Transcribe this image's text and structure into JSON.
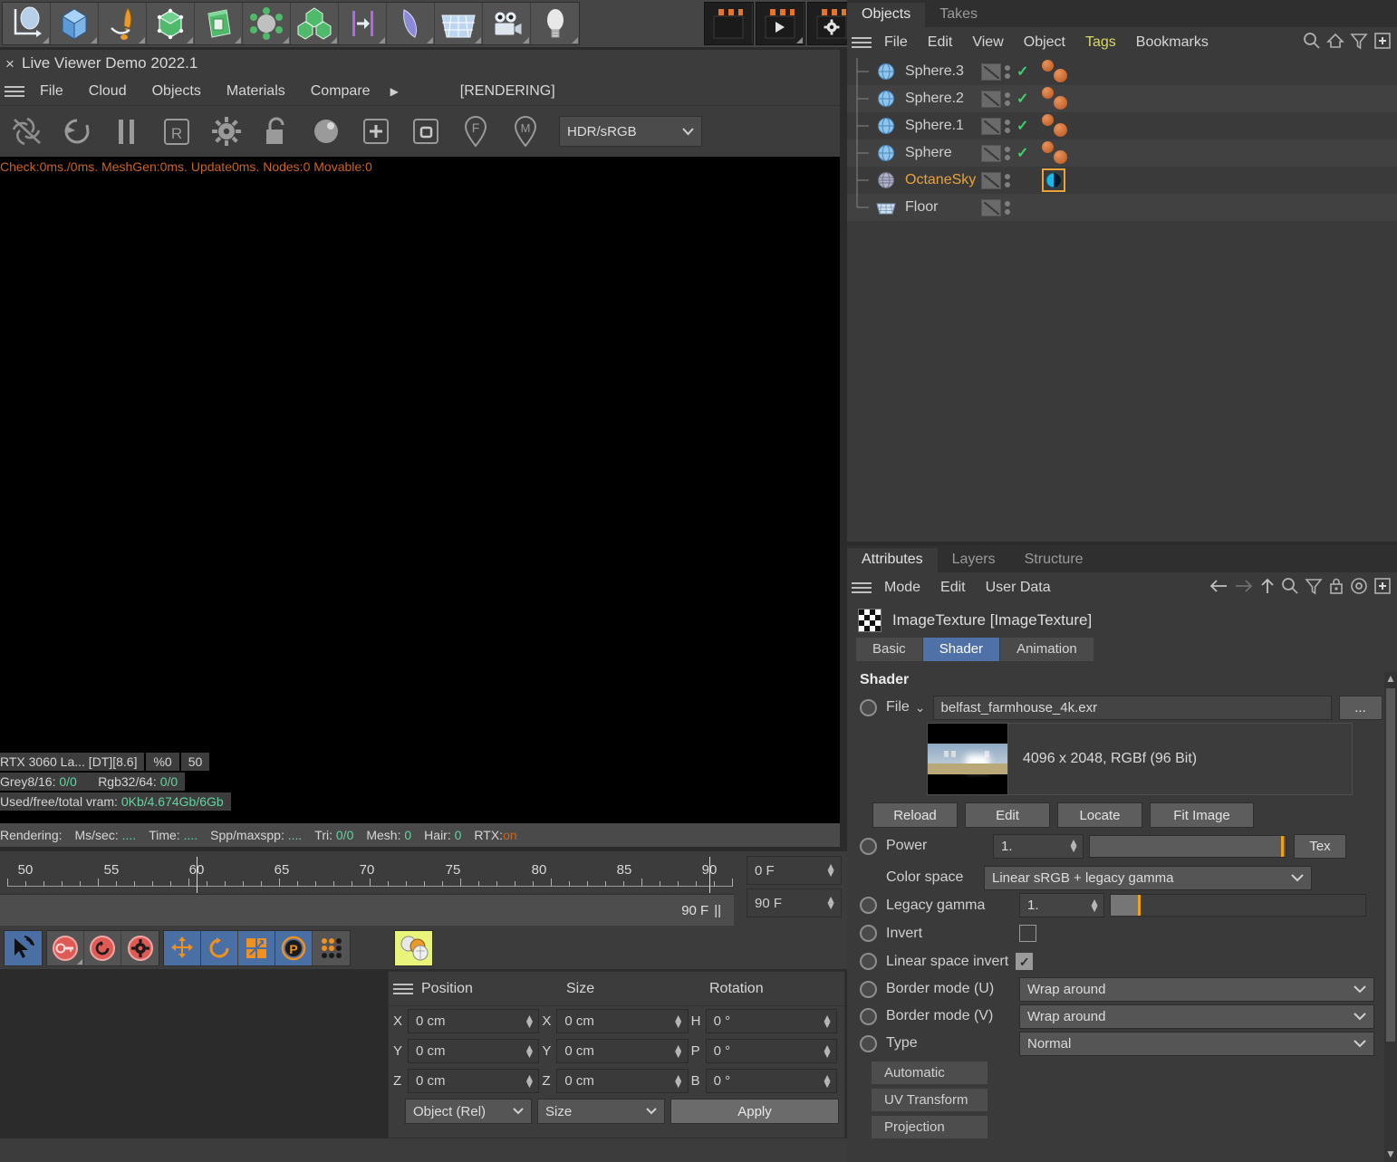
{
  "app": {
    "top_toolbar_icons": [
      "spline-pen-icon",
      "cube-primitive-icon",
      "pen-tool-icon",
      "subdivision-cube-icon",
      "extrude-cube-icon",
      "deformer-icon",
      "cloner-array-icon",
      "mograph-effector-icon",
      "bend-deformer-icon",
      "floor-grid-icon",
      "camera-icon",
      "light-bulb-icon"
    ],
    "render_buttons": [
      "render-view-icon",
      "render-play-icon",
      "render-settings-icon"
    ]
  },
  "live_viewer": {
    "title": "Live Viewer Demo 2022.1",
    "close_label": "×",
    "menu": [
      "File",
      "Cloud",
      "Objects",
      "Materials",
      "Compare"
    ],
    "menu_more": "▶",
    "render_state": "[RENDERING]",
    "toolbar_icons": [
      "stop-render-icon",
      "refresh-render-icon",
      "pause-render-icon",
      "region-render-icon",
      "render-settings-gear-icon",
      "lock-resolution-icon",
      "material-preview-icon",
      "add-object-icon",
      "add-region-icon",
      "focus-picker-icon",
      "material-picker-icon"
    ],
    "colorspace": "HDR/sRGB",
    "status_line": "Check:0ms./0ms.  MeshGen:0ms.  Update0ms.  Nodes:0  Movable:0",
    "stats": {
      "device": "RTX 3060 La... [DT][8.6]",
      "percent": "%0",
      "value": "50",
      "grey_label": "Grey8/16:",
      "grey_value": "0/0",
      "rgb_label": "Rgb32/64:",
      "rgb_value": "0/0",
      "vram_label": "Used/free/total vram:",
      "vram_value": "0Kb/4.674Gb/6Gb"
    },
    "bottom_status": {
      "rendering": "Rendering:",
      "mssec_label": "Ms/sec:",
      "mssec_value": "....",
      "time_label": "Time:",
      "time_value": "....",
      "spp_label": "Spp/maxspp:",
      "spp_value": "....",
      "tri_label": "Tri:",
      "tri_value": "0/0",
      "mesh_label": "Mesh:",
      "mesh_value": "0",
      "hair_label": "Hair:",
      "hair_value": "0",
      "rtx_label": "RTX:",
      "rtx_value": "on"
    }
  },
  "timeline": {
    "ticks": [
      "50",
      "55",
      "60",
      "65",
      "70",
      "75",
      "80",
      "85",
      "90"
    ],
    "current_frame": "0 F",
    "end_frame_track": "90 F",
    "end_frame": "90 F",
    "preview_handle": "||"
  },
  "bottom_toolbar": {
    "groups": [
      {
        "icons": [
          {
            "name": "selection-live-icon",
            "style": "blue"
          }
        ]
      },
      {
        "icons": [
          {
            "name": "key-record-icon",
            "style": "dark"
          },
          {
            "name": "autokey-icon",
            "style": "dark"
          },
          {
            "name": "keyframe-settings-icon",
            "style": "dark"
          }
        ]
      },
      {
        "icons": [
          {
            "name": "position-record-icon",
            "style": "blue"
          },
          {
            "name": "rotation-record-icon",
            "style": "blue"
          },
          {
            "name": "scale-record-icon",
            "style": "blue"
          },
          {
            "name": "pla-record-icon",
            "style": "blue"
          },
          {
            "name": "point-level-anim-icon",
            "style": "dark"
          }
        ]
      },
      {
        "icons": [
          {
            "name": "material-manager-icon",
            "style": "yellow"
          }
        ]
      }
    ]
  },
  "coordinates": {
    "columns": [
      "Position",
      "Size",
      "Rotation"
    ],
    "rows": [
      {
        "pos_axis": "X",
        "pos_value": "0 cm",
        "size_axis": "X",
        "size_value": "0 cm",
        "rot_axis": "H",
        "rot_value": "0 °"
      },
      {
        "pos_axis": "Y",
        "pos_value": "0 cm",
        "size_axis": "Y",
        "size_value": "0 cm",
        "rot_axis": "P",
        "rot_value": "0 °"
      },
      {
        "pos_axis": "Z",
        "pos_value": "0 cm",
        "size_axis": "Z",
        "size_value": "0 cm",
        "rot_axis": "B",
        "rot_value": "0 °"
      }
    ],
    "mode_select": "Object (Rel)",
    "size_select": "Size",
    "apply_label": "Apply"
  },
  "objects_panel": {
    "tabs": [
      {
        "label": "Objects",
        "active": true
      },
      {
        "label": "Takes",
        "active": false
      }
    ],
    "menu": [
      {
        "label": "File",
        "highlight": false
      },
      {
        "label": "Edit",
        "highlight": false
      },
      {
        "label": "View",
        "highlight": false
      },
      {
        "label": "Object",
        "highlight": false
      },
      {
        "label": "Tags",
        "highlight": true
      },
      {
        "label": "Bookmarks",
        "highlight": false
      }
    ],
    "header_icons": [
      "search-icon",
      "home-icon",
      "filter-icon",
      "plus-icon"
    ],
    "items": [
      {
        "label": "Sphere.3",
        "icon": "sphere-icon",
        "visible_check": true,
        "tags": "two-material-tags",
        "selected": false
      },
      {
        "label": "Sphere.2",
        "icon": "sphere-icon",
        "visible_check": true,
        "tags": "two-material-tags",
        "selected": false
      },
      {
        "label": "Sphere.1",
        "icon": "sphere-icon",
        "visible_check": true,
        "tags": "two-material-tags",
        "selected": false
      },
      {
        "label": "Sphere",
        "icon": "sphere-icon",
        "visible_check": true,
        "tags": "two-material-tags",
        "selected": false
      },
      {
        "label": "OctaneSky",
        "icon": "octane-sky-icon",
        "visible_check": false,
        "tags": "octane-sky-tag",
        "selected": true
      },
      {
        "label": "Floor",
        "icon": "floor-icon",
        "visible_check": false,
        "tags": "none",
        "selected": false
      }
    ]
  },
  "attributes_panel": {
    "tabs": [
      {
        "label": "Attributes",
        "active": true
      },
      {
        "label": "Layers",
        "active": false
      },
      {
        "label": "Structure",
        "active": false
      }
    ],
    "menu": [
      "Mode",
      "Edit",
      "User Data"
    ],
    "header_icons": [
      "back-arrow-icon",
      "forward-arrow-icon",
      "up-arrow-icon",
      "search-icon",
      "filter-icon",
      "lock-icon",
      "target-icon",
      "plus-icon"
    ],
    "object_title": "ImageTexture [ImageTexture]",
    "object_icon": "checker-texture-icon",
    "subtabs": [
      {
        "label": "Basic",
        "active": false
      },
      {
        "label": "Shader",
        "active": true
      },
      {
        "label": "Animation",
        "active": false
      }
    ],
    "section_title": "Shader",
    "file": {
      "label": "File",
      "dropdown_glyph": "⌄",
      "value": "belfast_farmhouse_4k.exr",
      "browse_label": "...",
      "image_info": "4096 x 2048, RGBf (96 Bit)",
      "buttons": [
        "Reload",
        "Edit",
        "Locate",
        "Fit Image"
      ]
    },
    "power": {
      "label": "Power",
      "value": "1.",
      "tex_button": "Tex"
    },
    "color_space": {
      "label": "Color space",
      "value": "Linear sRGB + legacy gamma"
    },
    "legacy_gamma": {
      "label": "Legacy gamma",
      "value": "1."
    },
    "invert": {
      "label": "Invert",
      "checked": false
    },
    "linear_space_invert": {
      "label": "Linear space invert",
      "checked": true
    },
    "border_mode_u": {
      "label": "Border mode (U)",
      "value": "Wrap around"
    },
    "border_mode_v": {
      "label": "Border mode (V)",
      "value": "Wrap around"
    },
    "type": {
      "label": "Type",
      "value": "Normal"
    },
    "stack_buttons": [
      "Automatic",
      "UV Transform",
      "Projection"
    ]
  },
  "colors": {
    "panel_bg": "#3a3a3a",
    "viewport_bg": "#000000",
    "accent_blue": "#4f71a8",
    "accent_orange": "#e8a33d",
    "status_orange": "#c8641e",
    "status_green": "#63d2a0",
    "slider_orange": "#f0a312",
    "check_green": "#3ecf6e"
  }
}
